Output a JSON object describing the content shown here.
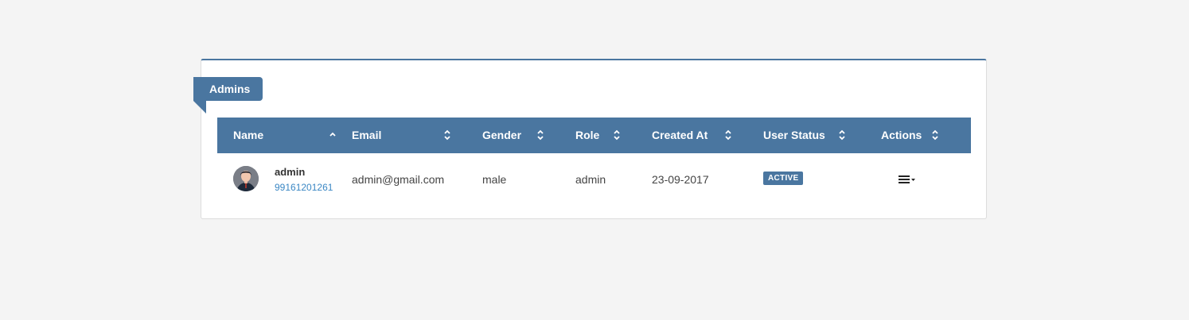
{
  "panel": {
    "title": "Admins"
  },
  "table": {
    "columns": [
      {
        "label": "Name",
        "sort": "asc"
      },
      {
        "label": "Email",
        "sort": "none"
      },
      {
        "label": "Gender",
        "sort": "none"
      },
      {
        "label": "Role",
        "sort": "none"
      },
      {
        "label": "Created At",
        "sort": "none"
      },
      {
        "label": "User Status",
        "sort": "none"
      },
      {
        "label": "Actions",
        "sort": "none"
      }
    ],
    "rows": [
      {
        "name": "admin",
        "phone": "99161201261",
        "email": "admin@gmail.com",
        "gender": "male",
        "role": "admin",
        "created_at": "23-09-2017",
        "status": "ACTIVE",
        "actions_icon": "menu-dropdown-icon"
      }
    ]
  },
  "colors": {
    "accent": "#4a76a0",
    "link": "#3a87c4",
    "background": "#f4f4f4"
  }
}
